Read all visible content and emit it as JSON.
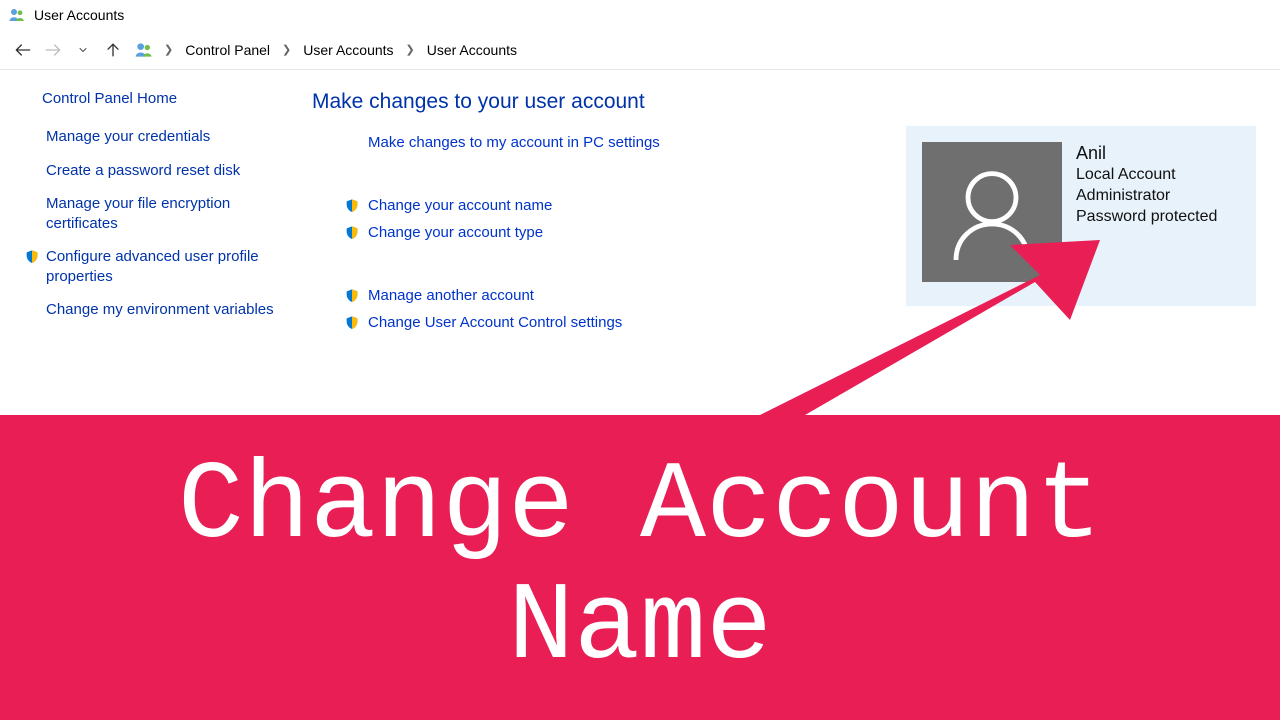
{
  "window": {
    "title": "User Accounts"
  },
  "breadcrumb": {
    "items": [
      "Control Panel",
      "User Accounts",
      "User Accounts"
    ]
  },
  "sidebar": {
    "home": "Control Panel Home",
    "links": [
      {
        "label": "Manage your credentials",
        "shield": false
      },
      {
        "label": "Create a password reset disk",
        "shield": false
      },
      {
        "label": "Manage your file encryption certificates",
        "shield": false
      },
      {
        "label": "Configure advanced user profile properties",
        "shield": true
      },
      {
        "label": "Change my environment variables",
        "shield": false
      }
    ]
  },
  "main": {
    "heading": "Make changes to your user account",
    "links": [
      {
        "label": "Make changes to my account in PC settings",
        "shield": false
      },
      {
        "label": "Change your account name",
        "shield": true
      },
      {
        "label": "Change your account type",
        "shield": true
      },
      {
        "label": "Manage another account",
        "shield": true
      },
      {
        "label": "Change User Account Control settings",
        "shield": true
      }
    ]
  },
  "user": {
    "name": "Anil",
    "type": "Local Account",
    "role": "Administrator",
    "protection": "Password protected"
  },
  "overlay": {
    "banner_line1": "Change Account",
    "banner_line2": "Name"
  }
}
